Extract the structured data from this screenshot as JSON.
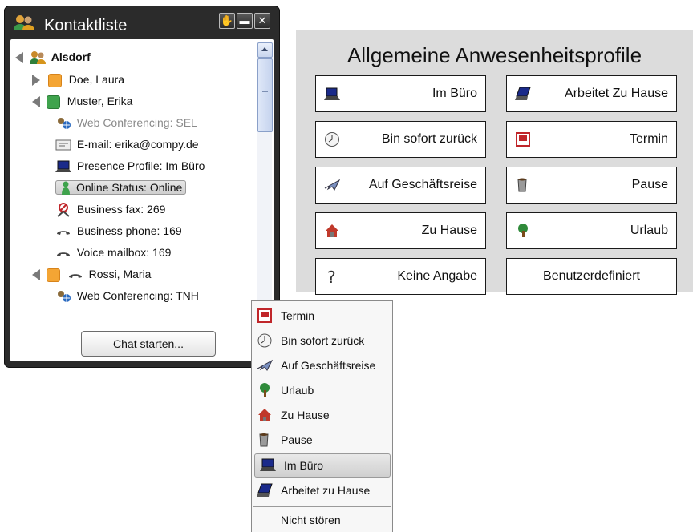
{
  "contact_window": {
    "title": "Kontaktliste",
    "group": "Alsdorf",
    "rows": [
      {
        "text": "Doe, Laura",
        "status": "orange"
      },
      {
        "text": "Muster, Erika",
        "status": "green"
      },
      {
        "text": "Web Conferencing: SEL"
      },
      {
        "text": "E-mail: erika@compy.de"
      },
      {
        "text": "Presence Profile: Im Büro"
      },
      {
        "text": "Online Status: Online"
      },
      {
        "text": "Business fax: 269"
      },
      {
        "text": "Business phone: 169"
      },
      {
        "text": "Voice mailbox: 169"
      },
      {
        "text": "Rossi, Maria",
        "status": "orange"
      },
      {
        "text": "Web Conferencing: TNH"
      }
    ],
    "chat_button": "Chat starten...",
    "colors": {
      "online_green": "#3fa34d",
      "busy_orange": "#f4a534",
      "frame": "#2b2b2b"
    }
  },
  "profiles_panel": {
    "title": "Allgemeine Anwesenheitsprofile",
    "buttons": [
      {
        "label": "Im Büro",
        "icon": "laptop-icon"
      },
      {
        "label": "Arbeitet Zu Hause",
        "icon": "laptop-home-icon"
      },
      {
        "label": "Bin sofort zurück",
        "icon": "clock-icon"
      },
      {
        "label": "Termin",
        "icon": "calendar-icon"
      },
      {
        "label": "Auf Geschäftsreise",
        "icon": "airplane-icon"
      },
      {
        "label": "Pause",
        "icon": "coffee-cup-icon"
      },
      {
        "label": "Zu Hause",
        "icon": "house-icon"
      },
      {
        "label": "Urlaub",
        "icon": "palm-tree-icon"
      },
      {
        "label": "Keine Angabe",
        "icon": "question-mark-icon"
      },
      {
        "label": "Benutzerdefiniert",
        "icon": ""
      }
    ]
  },
  "context_menu": {
    "items": [
      {
        "label": "Termin",
        "icon": "calendar-icon"
      },
      {
        "label": "Bin sofort zurück",
        "icon": "clock-icon"
      },
      {
        "label": "Auf Geschäftsreise",
        "icon": "airplane-icon"
      },
      {
        "label": "Urlaub",
        "icon": "palm-tree-icon"
      },
      {
        "label": "Zu Hause",
        "icon": "house-icon"
      },
      {
        "label": "Pause",
        "icon": "coffee-cup-icon"
      },
      {
        "label": "Im Büro",
        "icon": "laptop-icon",
        "highlighted": true
      },
      {
        "label": "Arbeitet zu Hause",
        "icon": "laptop-home-icon"
      },
      {
        "label": "Nicht stören",
        "icon": ""
      }
    ]
  }
}
